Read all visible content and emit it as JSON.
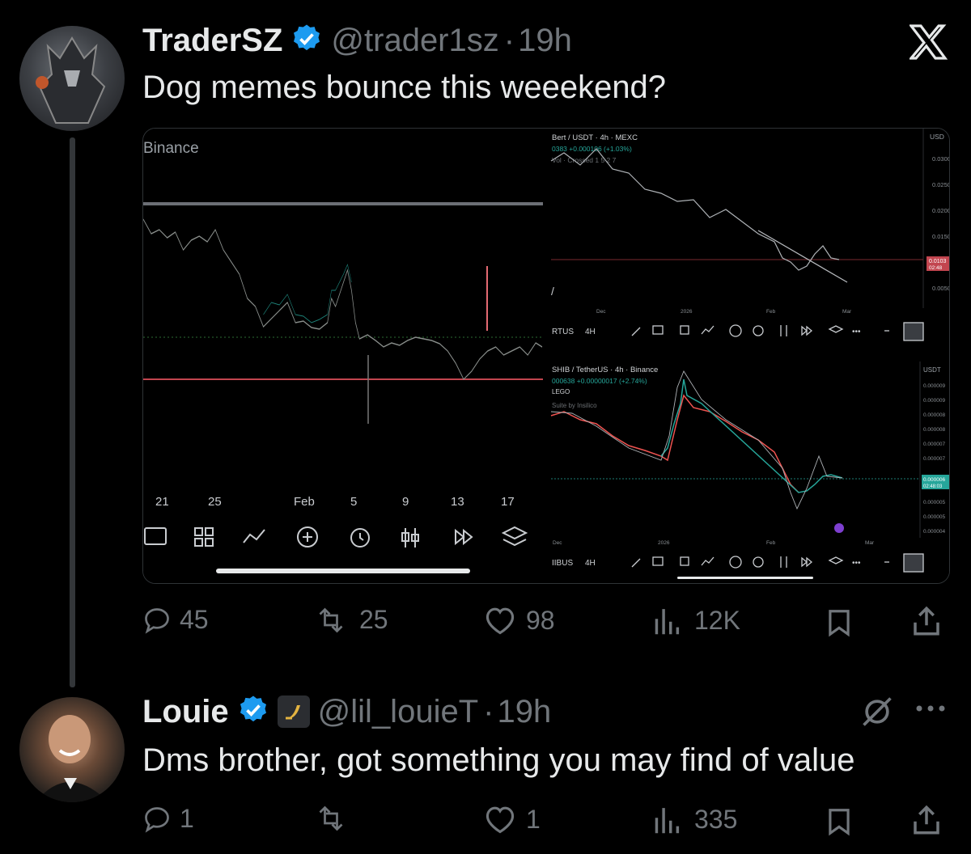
{
  "app": {
    "logo": "x-logo-icon"
  },
  "tweet": {
    "author_name": "TraderSZ",
    "verified": true,
    "handle": "@trader1sz",
    "separator": "·",
    "time": "19h",
    "text": "Dog memes bounce this weeekend?",
    "media": {
      "left_chart": {
        "exchange": "Binance",
        "x_ticks": [
          "21",
          "25",
          "Feb",
          "5",
          "9",
          "13",
          "17"
        ]
      },
      "top_right_chart": {
        "symbol": "Bert / USDT · 4h · MEXC",
        "quote": "0383 +0.000106 (+1.03%)",
        "indicator": "Vol · Crossed   1 5 2 7",
        "y_axis_unit": "USD",
        "y_ticks": [
          "0.0300",
          "0.0250",
          "0.0200",
          "0.0150",
          "0.0100",
          "0.0050"
        ],
        "price_tag": "0.0103",
        "price_tag_time": "02:48",
        "x_ticks": [
          "Dec",
          "2026",
          "Feb",
          "Mar"
        ],
        "toolbar_symbol": "RTUS",
        "toolbar_interval": "4H"
      },
      "bottom_right_chart": {
        "symbol": "SHIB / TetherUS · 4h · Binance",
        "quote": "000638 +0.00000017 (+2.74%)",
        "label": "LEGO",
        "indicator": "Suite by Insilico",
        "y_axis_unit": "USDT",
        "y_ticks": [
          "0.000009",
          "0.000009",
          "0.000008",
          "0.000008",
          "0.000007",
          "0.000007",
          "0.000006",
          "0.000005",
          "0.000005",
          "0.000004"
        ],
        "price_tag": "0.000006",
        "price_tag_time": "02:48:03",
        "x_ticks": [
          "Dec",
          "2026",
          "Feb",
          "Mar"
        ],
        "toolbar_symbol": "IIBUS",
        "toolbar_interval": "4H"
      }
    },
    "stats": {
      "replies": "45",
      "reposts": "25",
      "likes": "98",
      "views": "12K"
    }
  },
  "reply": {
    "author_name": "Louie",
    "verified": true,
    "handle": "@lil_louieT",
    "separator": "·",
    "time": "19h",
    "text": "Dms brother, got something you may find of value",
    "stats": {
      "replies": "1",
      "reposts": "",
      "likes": "1",
      "views": "335"
    }
  },
  "colors": {
    "background": "#000000",
    "text": "#e7e9ea",
    "muted": "#71767b",
    "verified": "#1d9bf0",
    "chart_green": "#26a69a",
    "chart_red": "#ef5350",
    "support_line": "#c2454f"
  }
}
